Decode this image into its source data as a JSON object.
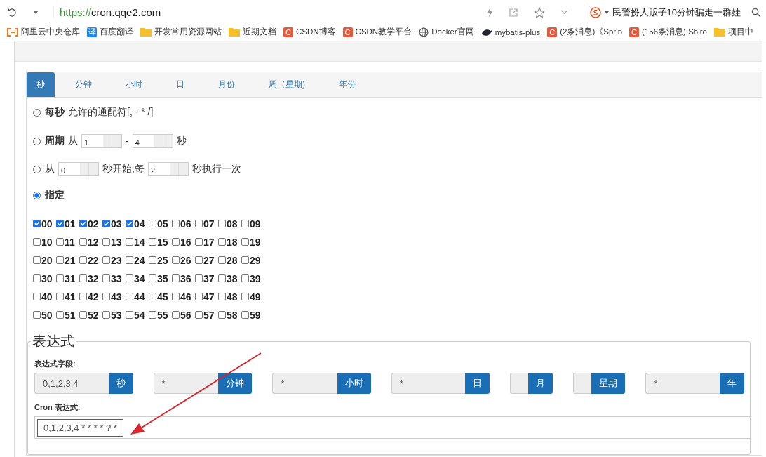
{
  "browser": {
    "url_scheme": "https://",
    "url_host": "cron.qqe2.com",
    "search_text": "民警扮人贩子10分钟骗走一群娃"
  },
  "bookmarks": [
    {
      "label": "阿里云中央仓库",
      "kind": "aliyun"
    },
    {
      "label": "百度翻译",
      "kind": "badge",
      "glyph": "译",
      "color": "#1e88e5"
    },
    {
      "label": "开发常用资源网站",
      "kind": "folder"
    },
    {
      "label": "近期文档",
      "kind": "folder"
    },
    {
      "label": "CSDN博客",
      "kind": "badge",
      "glyph": "C",
      "color": "#e45a3c"
    },
    {
      "label": "CSDN教学平台",
      "kind": "badge",
      "glyph": "C",
      "color": "#e45a3c"
    },
    {
      "label": "Docker官网",
      "kind": "globe"
    },
    {
      "label": "mybatis-plus",
      "kind": "bird"
    },
    {
      "label": "(2条消息)《Sprin",
      "kind": "badge",
      "glyph": "C",
      "color": "#e45a3c"
    },
    {
      "label": "(156条消息) Shiro",
      "kind": "badge",
      "glyph": "C",
      "color": "#e45a3c"
    },
    {
      "label": "项目中",
      "kind": "folder"
    }
  ],
  "tabs": [
    {
      "label": "秒",
      "selected": true
    },
    {
      "label": "分钟",
      "selected": false
    },
    {
      "label": "小时",
      "selected": false
    },
    {
      "label": "日",
      "selected": false
    },
    {
      "label": "月份",
      "selected": false
    },
    {
      "label": "周（星期)",
      "selected": false
    },
    {
      "label": "年份",
      "selected": false
    }
  ],
  "options": [
    {
      "kind": "every",
      "selected": false,
      "title": "每秒",
      "text": "允许的通配符[, - * /]"
    },
    {
      "kind": "range",
      "selected": false,
      "title": "周期",
      "from_label": "从",
      "from": "1",
      "separator": "-",
      "to": "4",
      "unit": "秒"
    },
    {
      "kind": "step",
      "selected": false,
      "from_label": "从",
      "start": "0",
      "middle": "秒开始,每",
      "step": "2",
      "unit": "秒执行一次"
    },
    {
      "kind": "specify",
      "selected": true,
      "title": "指定"
    }
  ],
  "checkboxes": [
    {
      "label": "00",
      "checked": true
    },
    {
      "label": "01",
      "checked": true
    },
    {
      "label": "02",
      "checked": true
    },
    {
      "label": "03",
      "checked": true
    },
    {
      "label": "04",
      "checked": true
    },
    {
      "label": "05",
      "checked": false
    },
    {
      "label": "06",
      "checked": false
    },
    {
      "label": "07",
      "checked": false
    },
    {
      "label": "08",
      "checked": false
    },
    {
      "label": "09",
      "checked": false
    },
    {
      "label": "10",
      "checked": false
    },
    {
      "label": "11",
      "checked": false
    },
    {
      "label": "12",
      "checked": false
    },
    {
      "label": "13",
      "checked": false
    },
    {
      "label": "14",
      "checked": false
    },
    {
      "label": "15",
      "checked": false
    },
    {
      "label": "16",
      "checked": false
    },
    {
      "label": "17",
      "checked": false
    },
    {
      "label": "18",
      "checked": false
    },
    {
      "label": "19",
      "checked": false
    },
    {
      "label": "20",
      "checked": false
    },
    {
      "label": "21",
      "checked": false
    },
    {
      "label": "22",
      "checked": false
    },
    {
      "label": "23",
      "checked": false
    },
    {
      "label": "24",
      "checked": false
    },
    {
      "label": "25",
      "checked": false
    },
    {
      "label": "26",
      "checked": false
    },
    {
      "label": "27",
      "checked": false
    },
    {
      "label": "28",
      "checked": false
    },
    {
      "label": "29",
      "checked": false
    },
    {
      "label": "30",
      "checked": false
    },
    {
      "label": "31",
      "checked": false
    },
    {
      "label": "32",
      "checked": false
    },
    {
      "label": "33",
      "checked": false
    },
    {
      "label": "34",
      "checked": false
    },
    {
      "label": "35",
      "checked": false
    },
    {
      "label": "36",
      "checked": false
    },
    {
      "label": "37",
      "checked": false
    },
    {
      "label": "38",
      "checked": false
    },
    {
      "label": "39",
      "checked": false
    },
    {
      "label": "40",
      "checked": false
    },
    {
      "label": "41",
      "checked": false
    },
    {
      "label": "42",
      "checked": false
    },
    {
      "label": "43",
      "checked": false
    },
    {
      "label": "44",
      "checked": false
    },
    {
      "label": "45",
      "checked": false
    },
    {
      "label": "46",
      "checked": false
    },
    {
      "label": "47",
      "checked": false
    },
    {
      "label": "48",
      "checked": false
    },
    {
      "label": "49",
      "checked": false
    },
    {
      "label": "50",
      "checked": false
    },
    {
      "label": "51",
      "checked": false
    },
    {
      "label": "52",
      "checked": false
    },
    {
      "label": "53",
      "checked": false
    },
    {
      "label": "54",
      "checked": false
    },
    {
      "label": "55",
      "checked": false
    },
    {
      "label": "56",
      "checked": false
    },
    {
      "label": "57",
      "checked": false
    },
    {
      "label": "58",
      "checked": false
    },
    {
      "label": "59",
      "checked": false
    }
  ],
  "expression": {
    "legend": "表达式",
    "fields_label": "表达式字段:",
    "fields": [
      {
        "value": "0,1,2,3,4",
        "unit": "秒"
      },
      {
        "value": "*",
        "unit": "分钟"
      },
      {
        "value": "*",
        "unit": "小时"
      },
      {
        "value": "*",
        "unit": "日"
      },
      {
        "unit": "月"
      },
      {
        "unit": "星期"
      },
      {
        "value": "*",
        "unit": "年"
      }
    ],
    "cron_label": "Cron 表达式:",
    "cron_value": "0,1,2,3,4 * * * * ? *",
    "cron_highlighted": true
  }
}
